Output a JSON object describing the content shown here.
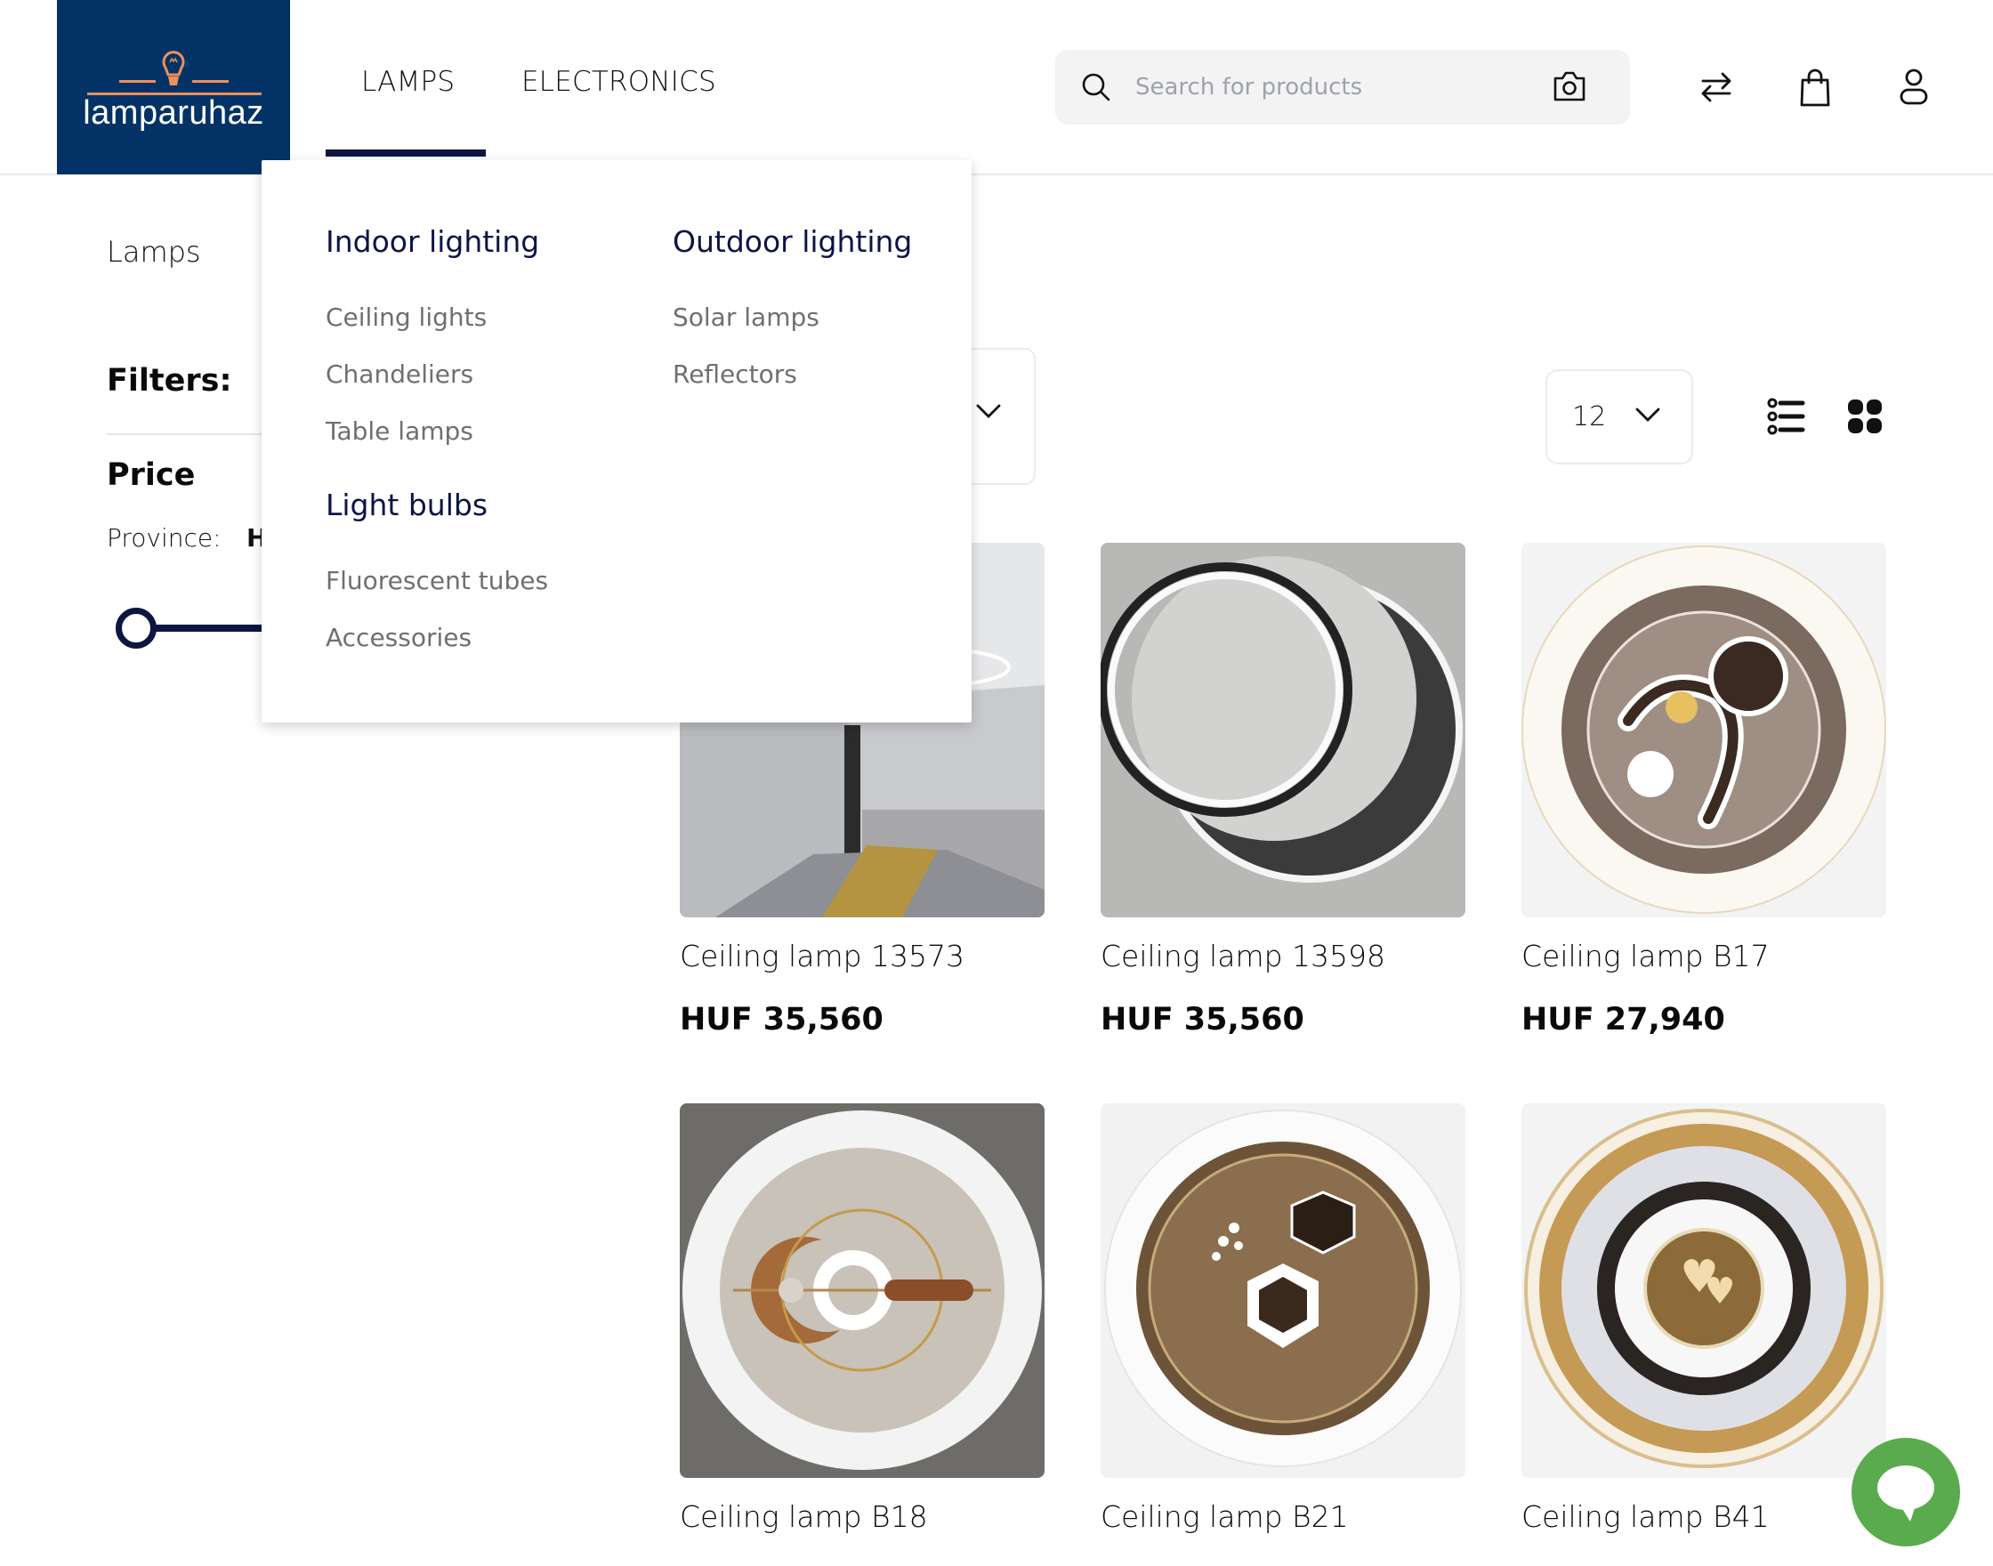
{
  "brand": {
    "name": "lamparuhaz",
    "bg_color": "#033366",
    "accent_color": "#ee8f5a"
  },
  "nav": {
    "items": [
      {
        "label": "LAMPS",
        "active": true
      },
      {
        "label": "ELECTRONICS",
        "active": false
      }
    ],
    "active_underline_color": "#0c1640"
  },
  "search": {
    "placeholder": "Search for products",
    "value": "",
    "icon": "search-icon",
    "image_search_icon": "camera-icon"
  },
  "header_icons": [
    {
      "name": "compare-icon"
    },
    {
      "name": "cart-bag-icon"
    },
    {
      "name": "user-account-icon"
    }
  ],
  "mega_menu": {
    "groups": [
      {
        "title": "Indoor lighting",
        "links": [
          "Ceiling lights",
          "Chandeliers",
          "Table lamps"
        ]
      },
      {
        "title": "Light bulbs",
        "links": [
          "Fluorescent tubes",
          "Accessories"
        ]
      },
      {
        "title": "Outdoor lighting",
        "links": [
          "Solar lamps",
          "Reflectors"
        ]
      }
    ]
  },
  "sidebar": {
    "breadcrumb": "Lamps",
    "filters_title": "Filters:",
    "price_title": "Price",
    "province_label": "Province:",
    "province_value": "H"
  },
  "toolbar": {
    "sort_value": "",
    "per_page": "12",
    "views": [
      {
        "name": "list-view-icon",
        "active": false
      },
      {
        "name": "grid-view-icon",
        "active": true
      }
    ]
  },
  "products": [
    {
      "title": "Ceiling lamp 13573",
      "price": "HUF 35,560"
    },
    {
      "title": "Ceiling lamp 13598",
      "price": "HUF 35,560"
    },
    {
      "title": "Ceiling lamp B17",
      "price": "HUF 27,940"
    },
    {
      "title": "Ceiling lamp B18",
      "price": ""
    },
    {
      "title": "Ceiling lamp B21",
      "price": ""
    },
    {
      "title": "Ceiling lamp B41",
      "price": ""
    }
  ],
  "chat": {
    "color": "#5aab4e",
    "icon": "chat-bubble-icon"
  }
}
